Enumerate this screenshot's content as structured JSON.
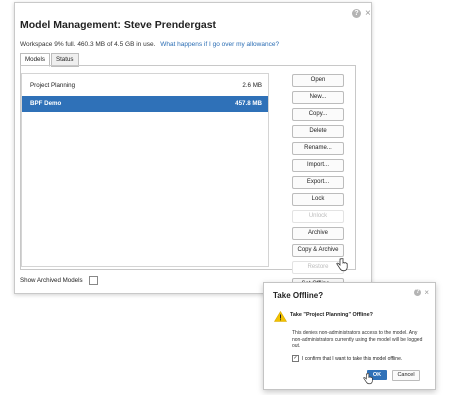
{
  "main_dialog": {
    "title": "Model Management: Steve Prendergast",
    "usage_text": "Workspace 9% full.  460.3 MB of 4.5 GB in use.",
    "usage_link": "What happens if I go over my allowance?",
    "tabs": [
      "Models",
      "Status"
    ],
    "models": [
      {
        "name": "Project Planning",
        "size": "2.6 MB",
        "selected": false
      },
      {
        "name": "BPF Demo",
        "size": "457.8 MB",
        "selected": true
      }
    ],
    "buttons": [
      {
        "label": "Open",
        "enabled": true
      },
      {
        "label": "New...",
        "enabled": true
      },
      {
        "label": "Copy...",
        "enabled": true
      },
      {
        "label": "Delete",
        "enabled": true
      },
      {
        "label": "Rename...",
        "enabled": true
      },
      {
        "label": "Import...",
        "enabled": true
      },
      {
        "label": "Export...",
        "enabled": true
      },
      {
        "label": "Lock",
        "enabled": true
      },
      {
        "label": "Unlock",
        "enabled": false
      },
      {
        "label": "Archive",
        "enabled": true
      },
      {
        "label": "Copy & Archive",
        "enabled": true
      },
      {
        "label": "Restore",
        "enabled": false
      },
      {
        "label": "Set Offline...",
        "enabled": true
      }
    ],
    "show_archived_label": "Show Archived Models"
  },
  "offline_dialog": {
    "title": "Take Offline?",
    "question": "Take \"Project Planning\" Offline?",
    "body": "This denies non-administrators access to the model. Any non-administrators currently using the model will be logged out.",
    "confirm_label": "I confirm that I want to take this model offline.",
    "confirm_checked": true,
    "ok_label": "OK",
    "cancel_label": "Cancel"
  },
  "colors": {
    "accent": "#2f71b8",
    "link": "#2a6db4",
    "warning": "#f2c200"
  },
  "icons": {
    "help": "?",
    "close": "×",
    "check": "✓"
  }
}
